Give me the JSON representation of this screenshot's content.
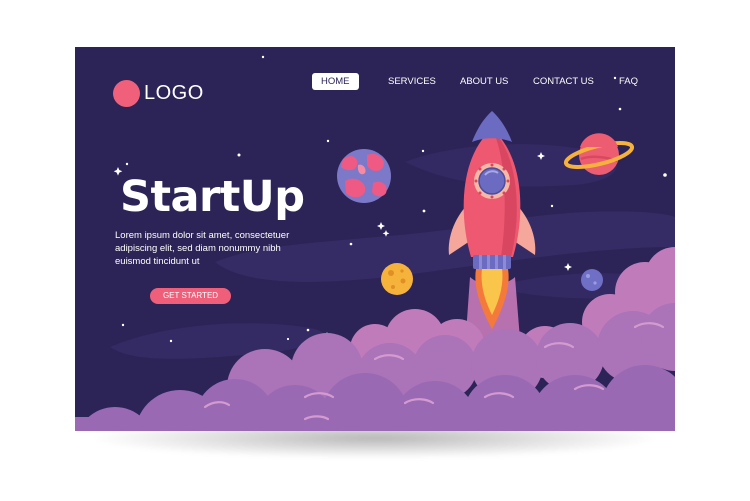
{
  "logo": {
    "text": "LOGO"
  },
  "nav": {
    "items": [
      {
        "label": "HOME",
        "active": true
      },
      {
        "label": "SERVICES",
        "active": false
      },
      {
        "label": "ABOUT US",
        "active": false
      },
      {
        "label": "CONTACT US",
        "active": false
      },
      {
        "label": "FAQ",
        "active": false
      }
    ]
  },
  "hero": {
    "title": "StartUp",
    "body": "Lorem ipsum dolor sit amet, consectetuer adipiscing elit, sed diam nonummy nibh euismod tincidunt ut",
    "cta_label": "GET STARTED"
  },
  "colors": {
    "background": "#2c2357",
    "accent": "#ef5f7a",
    "cloud": "#a372b8",
    "rocket": "#ee5871"
  }
}
